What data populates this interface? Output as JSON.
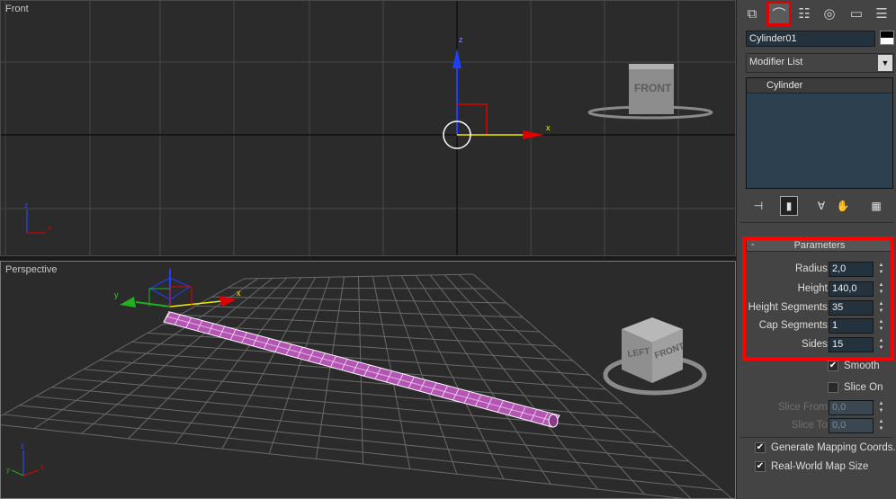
{
  "viewports": {
    "front": {
      "label": "Front",
      "axis_x": "x",
      "axis_z": "z",
      "viewcube_label": "FRONT"
    },
    "perspective": {
      "label": "Perspective",
      "axis_x": "x",
      "axis_y": "y",
      "axis_z": "z",
      "viewcube_left": "LEFT",
      "viewcube_front": "FRONT"
    }
  },
  "command_panel": {
    "tabs": [
      {
        "name": "create",
        "icon": "create-icon",
        "glyph": "⧉"
      },
      {
        "name": "modify",
        "icon": "modify-icon",
        "glyph": "⌒",
        "active": true
      },
      {
        "name": "hierarchy",
        "icon": "hierarchy-icon",
        "glyph": "☷"
      },
      {
        "name": "motion",
        "icon": "motion-icon",
        "glyph": "◎"
      },
      {
        "name": "display",
        "icon": "display-icon",
        "glyph": "▭"
      },
      {
        "name": "utilities",
        "icon": "utilities-icon",
        "glyph": "☰"
      }
    ],
    "object_name": "Cylinder01",
    "modifier_list": "Modifier List",
    "stack": [
      "Cylinder"
    ],
    "parameters": {
      "title": "Parameters",
      "collapse": "-",
      "radius": {
        "label": "Radius:",
        "value": "2,0"
      },
      "height": {
        "label": "Height:",
        "value": "140,0"
      },
      "height_segments": {
        "label": "Height Segments:",
        "value": "35"
      },
      "cap_segments": {
        "label": "Cap Segments:",
        "value": "1"
      },
      "sides": {
        "label": "Sides:",
        "value": "15"
      },
      "smooth": {
        "label": "Smooth",
        "checked": true
      },
      "slice_on": {
        "label": "Slice On",
        "checked": false
      },
      "slice_from": {
        "label": "Slice From:",
        "value": "0,0"
      },
      "slice_to": {
        "label": "Slice To:",
        "value": "0,0"
      },
      "gen_mapping": {
        "label": "Generate Mapping Coords.",
        "checked": true
      },
      "real_world": {
        "label": "Real-World Map Size",
        "checked": true
      }
    }
  },
  "colors": {
    "highlight": "#ff0000",
    "field_bg": "#23323d",
    "selected_wire": "#c040c0"
  }
}
